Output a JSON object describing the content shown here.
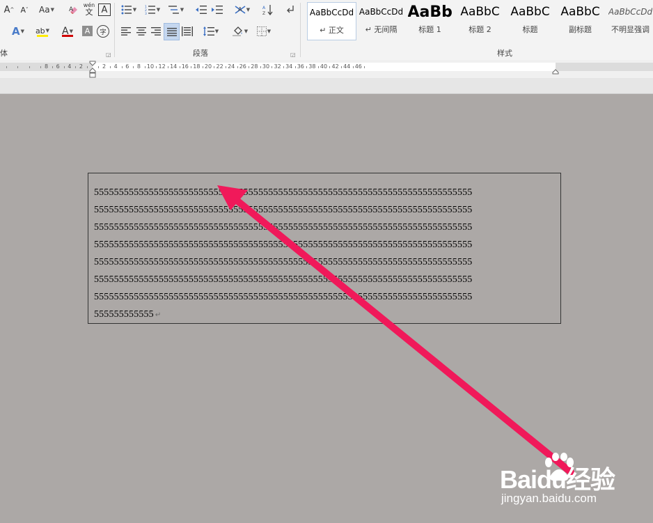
{
  "ribbon": {
    "font_group_label": "体",
    "paragraph_group_label": "段落",
    "styles_group_label": "样式",
    "font_buttons": {
      "grow": "A",
      "shrink": "A",
      "change_case": "Aa",
      "phonetic_top": "wén",
      "phonetic_bottom": "文",
      "char_border": "A",
      "text_effect": "A",
      "highlight": "ab",
      "font_color": "A",
      "char_shading": "A",
      "enclose": "字"
    },
    "styles": [
      {
        "sample": "AaBbCcDd",
        "name": "↵ 正文",
        "active": true
      },
      {
        "sample": "AaBbCcDd",
        "name": "↵ 无间隔",
        "active": false
      },
      {
        "sample": "AaBb",
        "name": "标题 1",
        "active": false
      },
      {
        "sample": "AaBbC",
        "name": "标题 2",
        "active": false
      },
      {
        "sample": "AaBbC",
        "name": "标题",
        "active": false
      },
      {
        "sample": "AaBbC",
        "name": "副标题",
        "active": false
      },
      {
        "sample": "AaBbCcDd",
        "name": "不明显强调",
        "active": false
      }
    ]
  },
  "ruler": {
    "numbers": [
      {
        "label": "8",
        "v": -8
      },
      {
        "label": "6",
        "v": -6
      },
      {
        "label": "4",
        "v": -4
      },
      {
        "label": "2",
        "v": -2
      },
      {
        "label": "2",
        "v": 2
      },
      {
        "label": "4",
        "v": 4
      },
      {
        "label": "6",
        "v": 6
      },
      {
        "label": "8",
        "v": 8
      },
      {
        "label": "10",
        "v": 10
      },
      {
        "label": "12",
        "v": 12
      },
      {
        "label": "14",
        "v": 14
      },
      {
        "label": "16",
        "v": 16
      },
      {
        "label": "18",
        "v": 18
      },
      {
        "label": "20",
        "v": 20
      },
      {
        "label": "22",
        "v": 22
      },
      {
        "label": "24",
        "v": 24
      },
      {
        "label": "26",
        "v": 26
      },
      {
        "label": "28",
        "v": 28
      },
      {
        "label": "30",
        "v": 30
      },
      {
        "label": "32",
        "v": 32
      },
      {
        "label": "34",
        "v": 34
      },
      {
        "label": "36",
        "v": 36
      },
      {
        "label": "38",
        "v": 38
      },
      {
        "label": "40",
        "v": 40
      },
      {
        "label": "42",
        "v": 42
      },
      {
        "label": "44",
        "v": 44
      },
      {
        "label": "46",
        "v": 46
      }
    ]
  },
  "document": {
    "lines": [
      "5555555555555555555555555555555555555555555555555555555555555555555555555555",
      "5555555555555555555555555555555555555555555555555555555555555555555555555555",
      "5555555555555555555555555555555555555555555555555555555555555555555555555555",
      "5555555555555555555555555555555555555555555555555555555555555555555555555555",
      "5555555555555555555555555555555555555555555555555555555555555555555555555555",
      "5555555555555555555555555555555555555555555555555555555555555555555555555555",
      "5555555555555555555555555555555555555555555555555555555555555555555555555555",
      "555555555555"
    ],
    "paragraph_mark": "↵"
  },
  "annotation": {
    "color": "#f0195a"
  },
  "watermark": {
    "brand": "Baidu经验",
    "url": "jingyan.baidu.com"
  }
}
